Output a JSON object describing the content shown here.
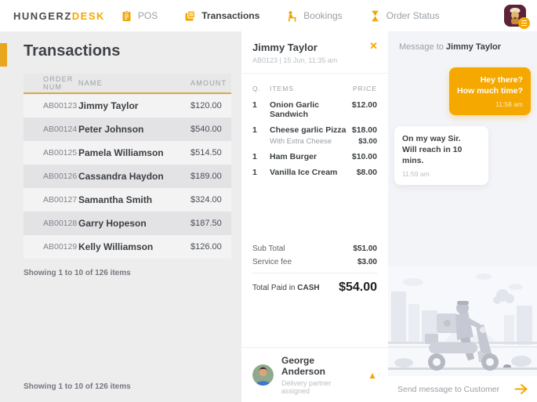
{
  "colors": {
    "accent": "#F5A800",
    "accent_dark": "#E9A51C",
    "text_dark": "#3C4043",
    "text_grey": "#9AA0A6",
    "panel_grey": "#EDEDEE",
    "avatar_bg": "#5C2237"
  },
  "icons": {
    "pos": "clipboard",
    "transactions": "receipt-cards",
    "bookings": "dine-in-person",
    "order_status": "hourglass",
    "profile_menu": "hamburger-badge",
    "close": "✕",
    "expand": "▲",
    "send": "paper-plane"
  },
  "header": {
    "logo": {
      "primary": "HUNGERZ",
      "accent": "DESK"
    },
    "nav": [
      {
        "label": "POS",
        "active": false
      },
      {
        "label": "Transactions",
        "active": true
      },
      {
        "label": "Bookings",
        "active": false
      },
      {
        "label": "Order Status",
        "active": false
      }
    ]
  },
  "transactions_panel": {
    "title": "Transactions",
    "columns": [
      "ORDER NUM",
      "NAME",
      "AMOUNT"
    ],
    "rows": [
      {
        "order_num": "AB00123",
        "name": "Jimmy Taylor",
        "amount": "$120.00"
      },
      {
        "order_num": "AB00124",
        "name": "Peter Johnson",
        "amount": "$540.00"
      },
      {
        "order_num": "AB00125",
        "name": "Pamela Williamson",
        "amount": "$514.50"
      },
      {
        "order_num": "AB00126",
        "name": "Cassandra Haydon",
        "amount": "$189.00"
      },
      {
        "order_num": "AB00127",
        "name": "Samantha Smith",
        "amount": "$324.00"
      },
      {
        "order_num": "AB00128",
        "name": "Garry Hopeson",
        "amount": "$187.50"
      },
      {
        "order_num": "AB00129",
        "name": "Kelly Williamson",
        "amount": "$126.00"
      }
    ],
    "showing_text": "Showing 1 to 10 of 126 items",
    "footer_text": "Showing 1 to 10 of 126 items"
  },
  "order_detail": {
    "customer_name": "Jimmy Taylor",
    "order_meta": "AB0123 | 15 Jun, 11:35 am",
    "columns": {
      "qty": "Q.",
      "items": "ITEMS",
      "price": "PRICE"
    },
    "items": [
      {
        "qty": "1",
        "name": "Onion Garlic Sandwich",
        "price": "$12.00"
      },
      {
        "qty": "1",
        "name": "Cheese garlic Pizza",
        "price": "$18.00"
      },
      {
        "qty": "1",
        "name": "Ham Burger",
        "price": "$10.00"
      },
      {
        "qty": "1",
        "name": "Vanilla Ice Cream",
        "price": "$8.00"
      }
    ],
    "addon": {
      "name": "With Extra Cheese",
      "price": "$3.00"
    },
    "totals": {
      "subtotal_label": "Sub Total",
      "subtotal_value": "$51.00",
      "service_label": "Service fee",
      "service_value": "$3.00",
      "total_label_prefix": "Total Paid in ",
      "total_method": "CASH",
      "total_value": "$54.00"
    },
    "delivery": {
      "name": "George Anderson",
      "status": "Delivery partner assigned"
    }
  },
  "chat_panel": {
    "header_prefix": "Message to ",
    "header_name": "Jimmy Taylor",
    "messages": [
      {
        "from": "customer",
        "line1": "Hey there?",
        "line2": "How much time?",
        "time": "11:58 am"
      },
      {
        "from": "agent",
        "line1": "On my way Sir.",
        "line2": "Will reach in 10 mins.",
        "time": "11:59 am"
      }
    ],
    "input_placeholder": "Send message to Customer"
  }
}
